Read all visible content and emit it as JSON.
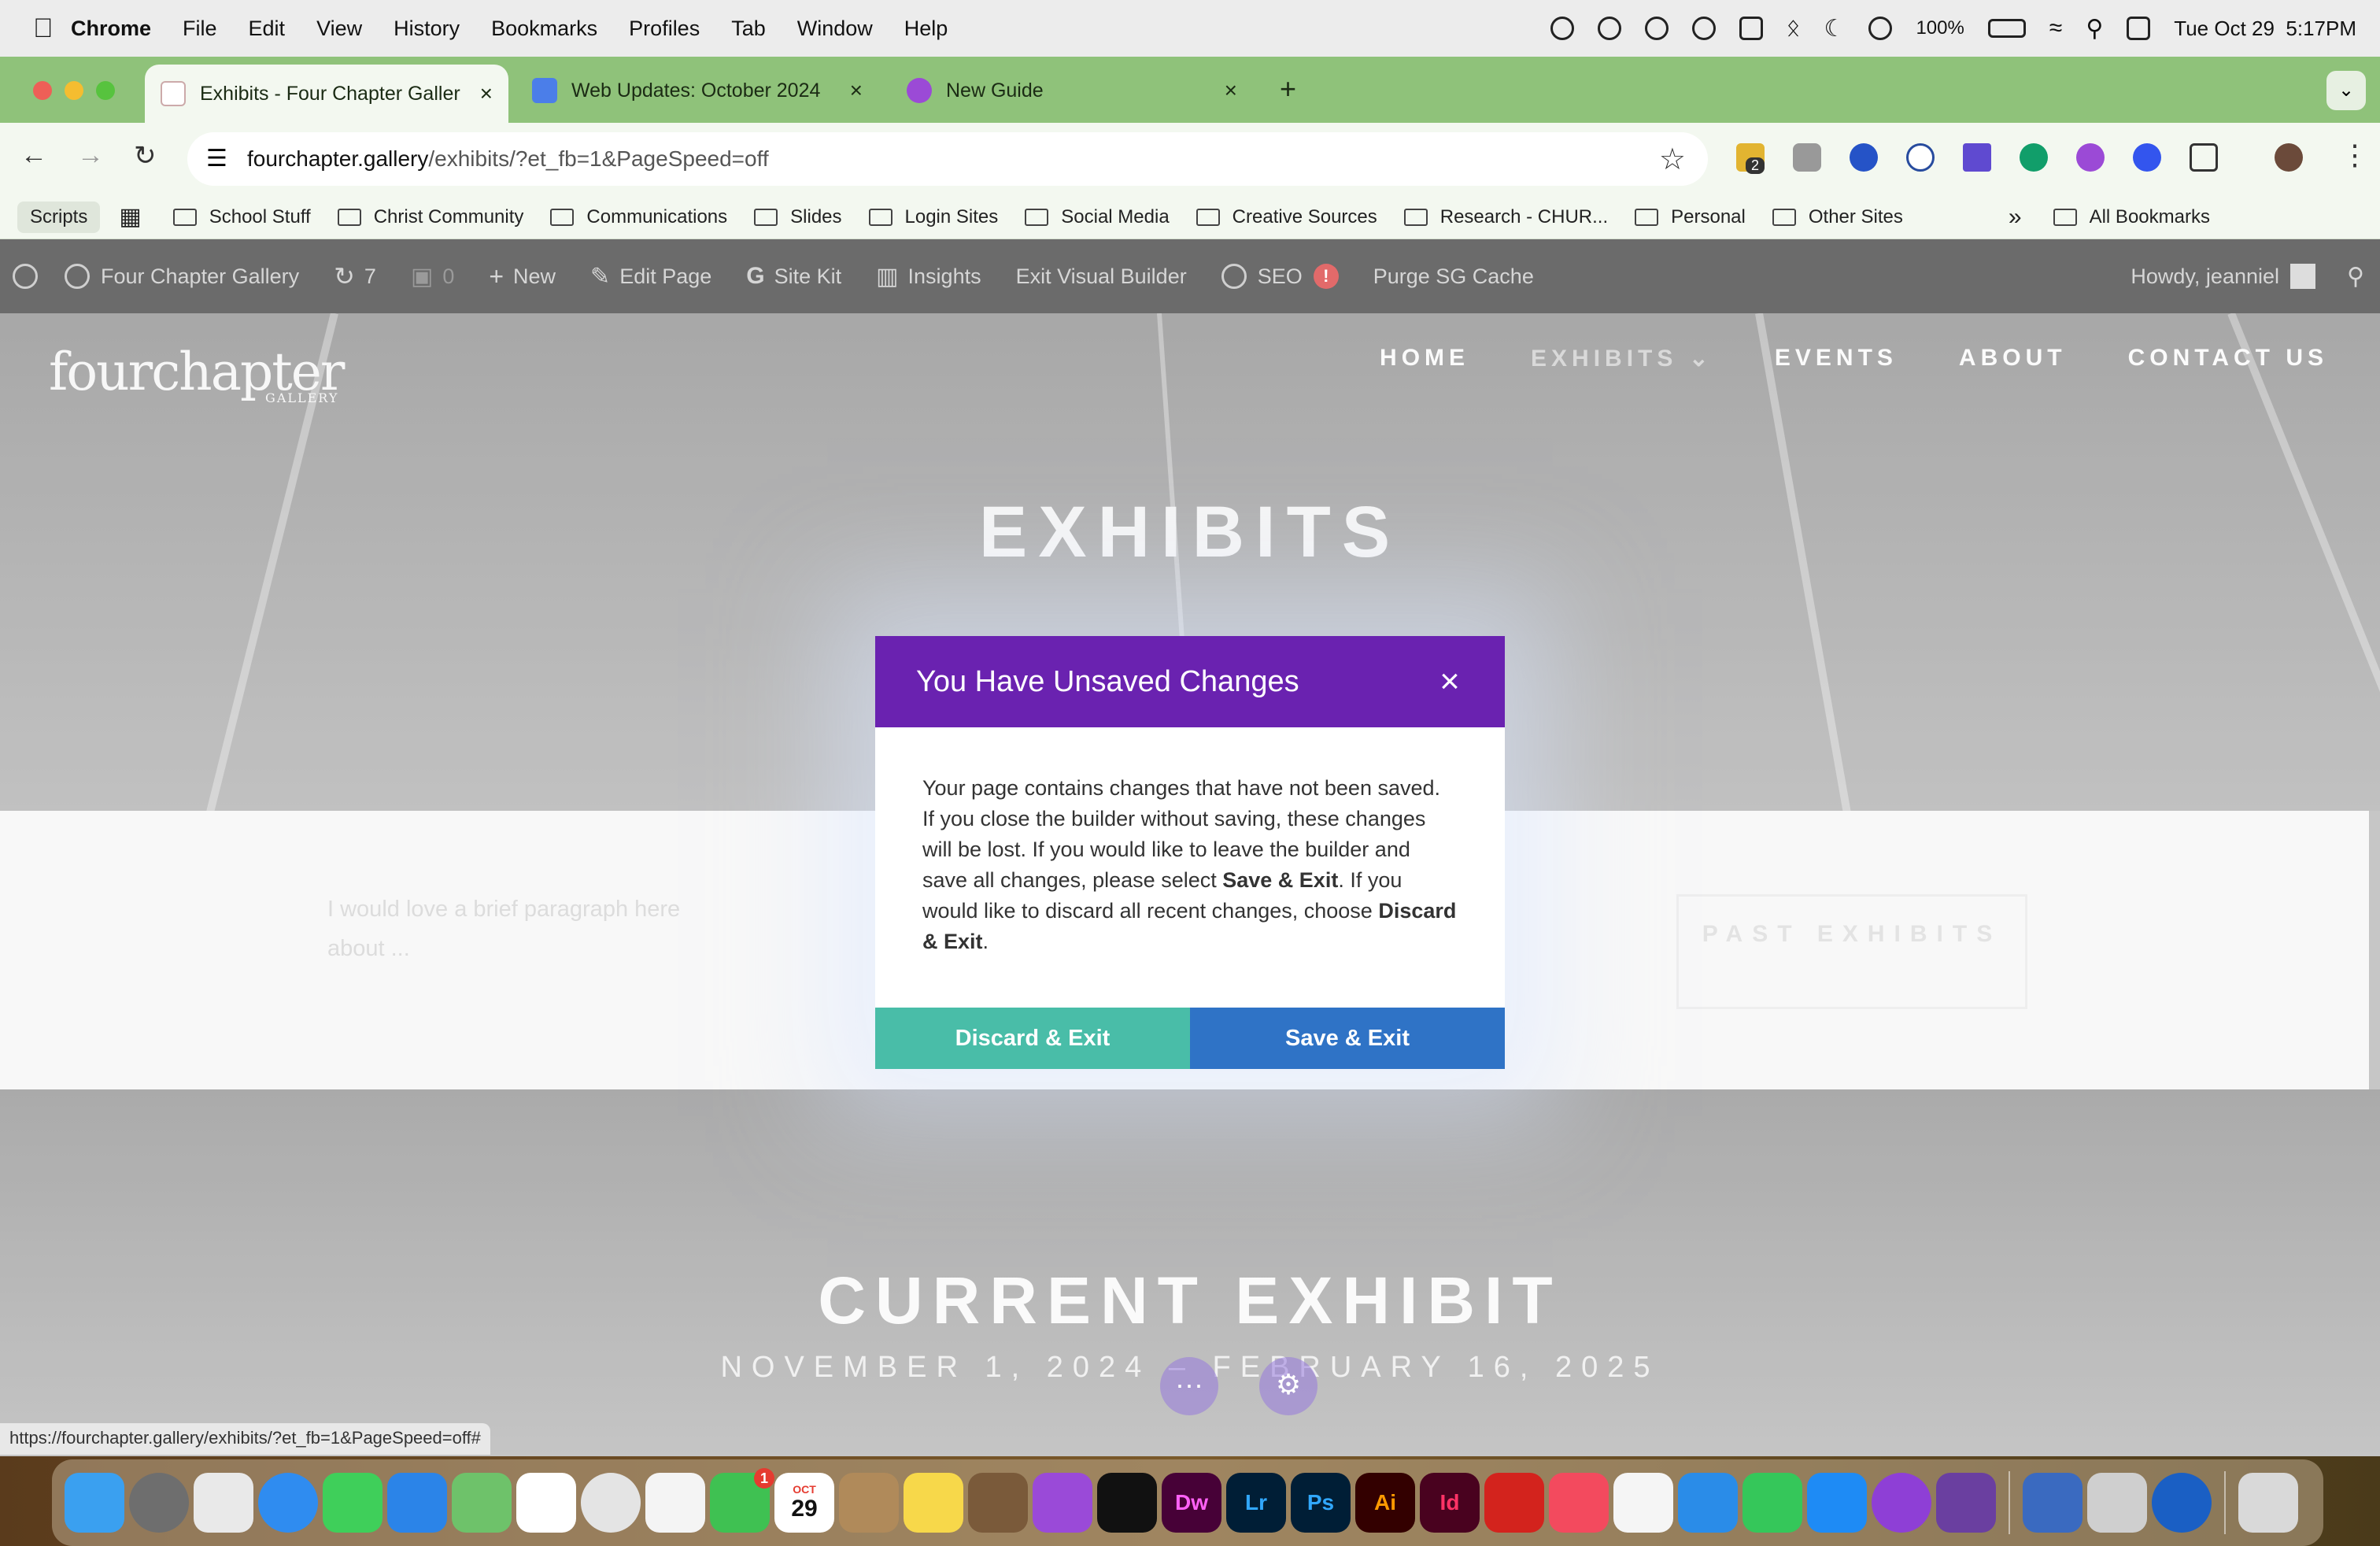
{
  "menubar": {
    "app": "Chrome",
    "menus": [
      "File",
      "Edit",
      "View",
      "History",
      "Bookmarks",
      "Profiles",
      "Tab",
      "Window",
      "Help"
    ],
    "battery": "100%",
    "datetime": "Tue Oct 29  5:17PM"
  },
  "tabs": [
    {
      "title": "Exhibits - Four Chapter Galler",
      "close": "×"
    },
    {
      "title": "Web Updates: October 2024",
      "close": "×"
    },
    {
      "title": "New Guide",
      "close": "×"
    }
  ],
  "new_tab": "+",
  "address": {
    "domain": "fourchapter.gallery",
    "path": "/exhibits/?et_fb=1&PageSpeed=off"
  },
  "extension_badge": "2",
  "bookmarks": {
    "scripts": "Scripts",
    "items": [
      "School Stuff",
      "Christ Community",
      "Communications",
      "Slides",
      "Login Sites",
      "Social Media",
      "Creative Sources",
      "Research - CHUR...",
      "Personal",
      "Other Sites"
    ],
    "overflow": "»",
    "all": "All Bookmarks"
  },
  "wpbar": {
    "site": "Four Chapter Gallery",
    "updates": "7",
    "comments": "0",
    "new": "New",
    "edit": "Edit Page",
    "sitekit": "Site Kit",
    "insights": "Insights",
    "exit_vb": "Exit Visual Builder",
    "seo": "SEO",
    "seo_badge": "!",
    "purge": "Purge SG Cache",
    "howdy": "Howdy, jeanniel"
  },
  "site": {
    "logo": "fourchapter",
    "logo_sub": "GALLERY",
    "nav": [
      "HOME",
      "EXHIBITS",
      "EVENTS",
      "ABOUT",
      "CONTACT US"
    ],
    "nav_caret": "⌄",
    "hero_title": "EXHIBITS",
    "placeholder": "I would love a brief paragraph here about ...",
    "past_button": "PAST EXHIBITS",
    "current_title": "CURRENT EXHIBIT",
    "current_dates": "NOVEMBER 1, 2024 – FEBRUARY 16, 2025",
    "fab_more": "···",
    "fab_settings": "⚙"
  },
  "modal": {
    "title": "You Have Unsaved Changes",
    "close": "×",
    "body_1": "Your page contains changes that have not been saved. If you close the builder without saving, these changes will be lost. If you would like to leave the builder and save all changes, please select ",
    "body_b1": "Save & Exit",
    "body_2": ". If you would like to discard all recent changes, choose ",
    "body_b2": "Discard & Exit",
    "body_3": ".",
    "discard": "Discard & Exit",
    "save": "Save & Exit"
  },
  "status_url": "https://fourchapter.gallery/exhibits/?et_fb=1&PageSpeed=off#",
  "dock": {
    "calendar_month": "OCT",
    "calendar_day": "29",
    "apps": [
      "Dw",
      "Lr",
      "Ps",
      "Ai",
      "Id"
    ],
    "facetime_badge": "1"
  }
}
